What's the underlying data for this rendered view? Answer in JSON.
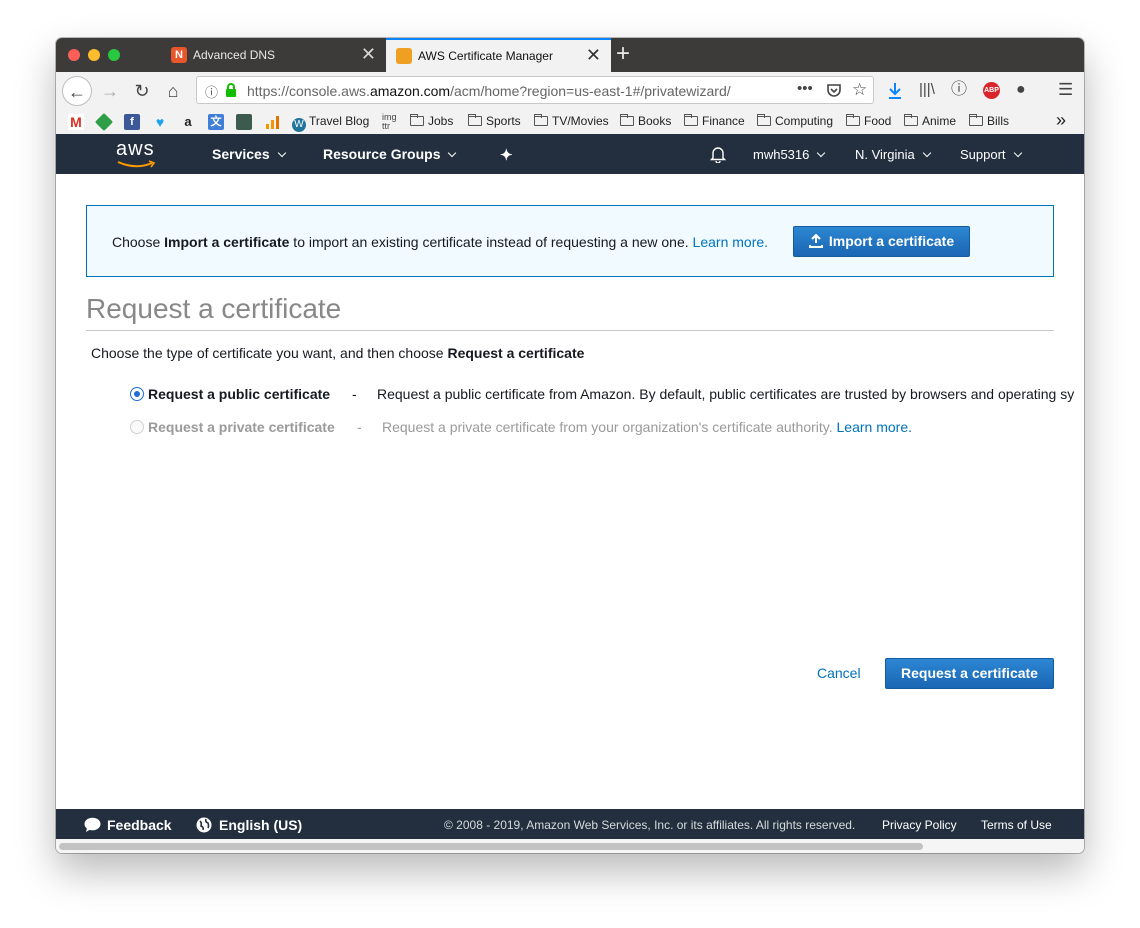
{
  "browser": {
    "tabs": [
      {
        "title": "Advanced DNS",
        "close": "✕",
        "favicon_color": "#e8572b"
      },
      {
        "title": "AWS Certificate Manager",
        "close": "✕",
        "favicon_color": "#f0a020"
      }
    ],
    "new_tab": "+",
    "url_prefix": "https://console.aws.",
    "url_domain": "amazon.com",
    "url_path": "/acm/home?region=us-east-1#/privatewizard/",
    "bookmarks": [
      {
        "label": "Travel Blog"
      },
      {
        "label": "Jobs"
      },
      {
        "label": "Sports"
      },
      {
        "label": "TV/Movies"
      },
      {
        "label": "Books"
      },
      {
        "label": "Finance"
      },
      {
        "label": "Computing"
      },
      {
        "label": "Food"
      },
      {
        "label": "Anime"
      },
      {
        "label": "Bills"
      }
    ],
    "overflow": "»"
  },
  "aws_header": {
    "logo": "aws",
    "services": "Services",
    "resource_groups": "Resource Groups",
    "user": "mwh5316",
    "region": "N. Virginia",
    "support": "Support"
  },
  "info_box": {
    "text_pre": "Choose ",
    "text_bold": "Import a certificate",
    "text_post": " to import an existing certificate instead of requesting a new one. ",
    "learn_more": "Learn more.",
    "import_button": "Import a certificate"
  },
  "page": {
    "title": "Request a certificate",
    "subtitle_pre": "Choose the type of certificate you want, and then choose ",
    "subtitle_bold": "Request a certificate"
  },
  "options": [
    {
      "label": "Request a public certificate",
      "dash": "-",
      "description": "Request a public certificate from Amazon. By default, public certificates are trusted by browsers and operating sy",
      "selected": true
    },
    {
      "label": "Request a private certificate",
      "dash": "-",
      "description": "Request a private certificate from your organization's certificate authority.",
      "learn_more": "Learn more.",
      "selected": false
    }
  ],
  "actions": {
    "cancel": "Cancel",
    "submit": "Request a certificate"
  },
  "footer": {
    "feedback": "Feedback",
    "language": "English (US)",
    "copyright": "© 2008 - 2019, Amazon Web Services, Inc. or its affiliates. All rights reserved.",
    "privacy": "Privacy Policy",
    "terms": "Terms of Use"
  },
  "colors": {
    "aws_navy": "#232f3e",
    "link_blue": "#0073bb",
    "info_bg": "#f1faff"
  }
}
